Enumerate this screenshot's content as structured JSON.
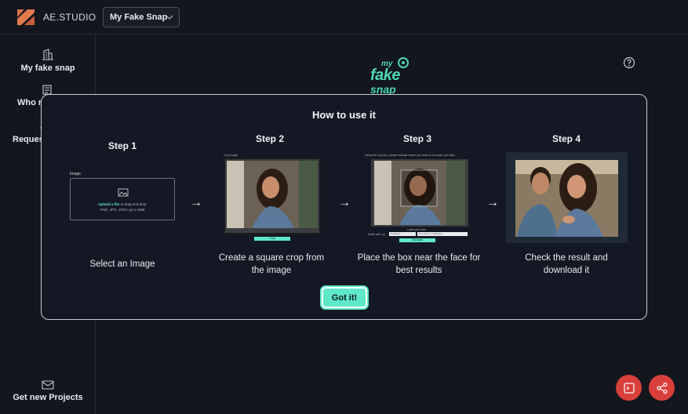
{
  "header": {
    "brand": "AE.STUDIO",
    "project_selected": "My Fake Snap"
  },
  "sidebar": {
    "items": [
      {
        "label": "My fake snap",
        "icon": "building-icon"
      },
      {
        "label": "Who m",
        "icon": "document-icon"
      },
      {
        "label": "Reques",
        "icon": "plus-icon"
      },
      {
        "label": "Get new Projects",
        "icon": "mail-icon"
      }
    ]
  },
  "main": {
    "brand_logo": {
      "line1": "my",
      "line2": "fake",
      "line3": "snap"
    }
  },
  "modal": {
    "title": "How to use it",
    "steps": [
      {
        "title": "Step 1",
        "description": "Select an Image",
        "preview": {
          "label": "Image",
          "upload_link": "Upload a file",
          "upload_rest": " or drag and drop",
          "formats": "PNG, JPG, JPEG up to 4MB"
        }
      },
      {
        "title": "Step 2",
        "description": "Create a square crop from the image",
        "preview": {
          "label": "Crop Image",
          "button": "Crop"
        }
      },
      {
        "title": "Step 3",
        "description": "Place the box near the face for best results",
        "preview": {
          "instruction": "Using the crop box, please indicate where you want us to create your fake.",
          "field_title": "Label your fake",
          "field1_label": "Selfie with my",
          "field1_value": "boyfriend",
          "field2_value": "Ex: name or nickname",
          "button": "Generate"
        }
      },
      {
        "title": "Step 4",
        "description": "Check the result and download it"
      }
    ],
    "confirm_button": "Got it!"
  },
  "colors": {
    "accent": "#5ee8c9",
    "fab": "#d9403b",
    "background": "#13161d"
  }
}
